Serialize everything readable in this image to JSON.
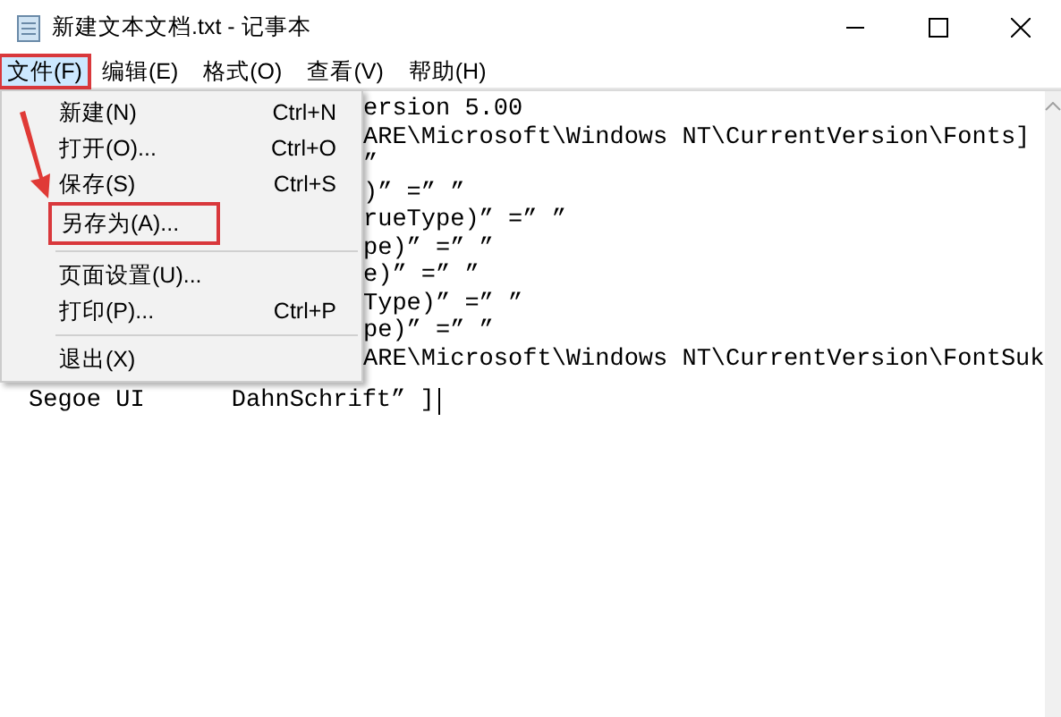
{
  "window": {
    "title": "新建文本文档.txt - 记事本"
  },
  "menu_bar": [
    {
      "label": "文件(F)",
      "selected": true
    },
    {
      "label": "编辑(E)",
      "selected": false
    },
    {
      "label": "格式(O)",
      "selected": false
    },
    {
      "label": "查看(V)",
      "selected": false
    },
    {
      "label": "帮助(H)",
      "selected": false
    }
  ],
  "editor": {
    "lines": [
      "ersion 5.00",
      "ARE\\Microsoft\\Windows NT\\CurrentVersion\\Fonts]",
      "”",
      ")” =” ”",
      "rueType)” =” ”",
      "pe)” =” ”",
      "e)” =” ”",
      "Type)” =” ”",
      "pe)” =” ”",
      "ARE\\Microsoft\\Windows NT\\CurrentVersion\\FontSuk",
      "Segoe UI      DahnSchrift” ]"
    ]
  },
  "file_menu": {
    "items": [
      {
        "kind": "item",
        "label": "新建(N)",
        "shortcut": "Ctrl+N",
        "marked": false
      },
      {
        "kind": "item",
        "label": "打开(O)...",
        "shortcut": "Ctrl+O",
        "marked": false
      },
      {
        "kind": "item",
        "label": "保存(S)",
        "shortcut": "Ctrl+S",
        "marked": false
      },
      {
        "kind": "item",
        "label": "另存为(A)...",
        "marked": true
      },
      {
        "kind": "separator"
      },
      {
        "kind": "item",
        "label": "页面设置(U)...",
        "marked": false
      },
      {
        "kind": "item",
        "label": "打印(P)...",
        "shortcut": "Ctrl+P",
        "marked": false
      },
      {
        "kind": "separator"
      },
      {
        "kind": "item",
        "label": "退出(X)",
        "marked": false
      }
    ]
  }
}
